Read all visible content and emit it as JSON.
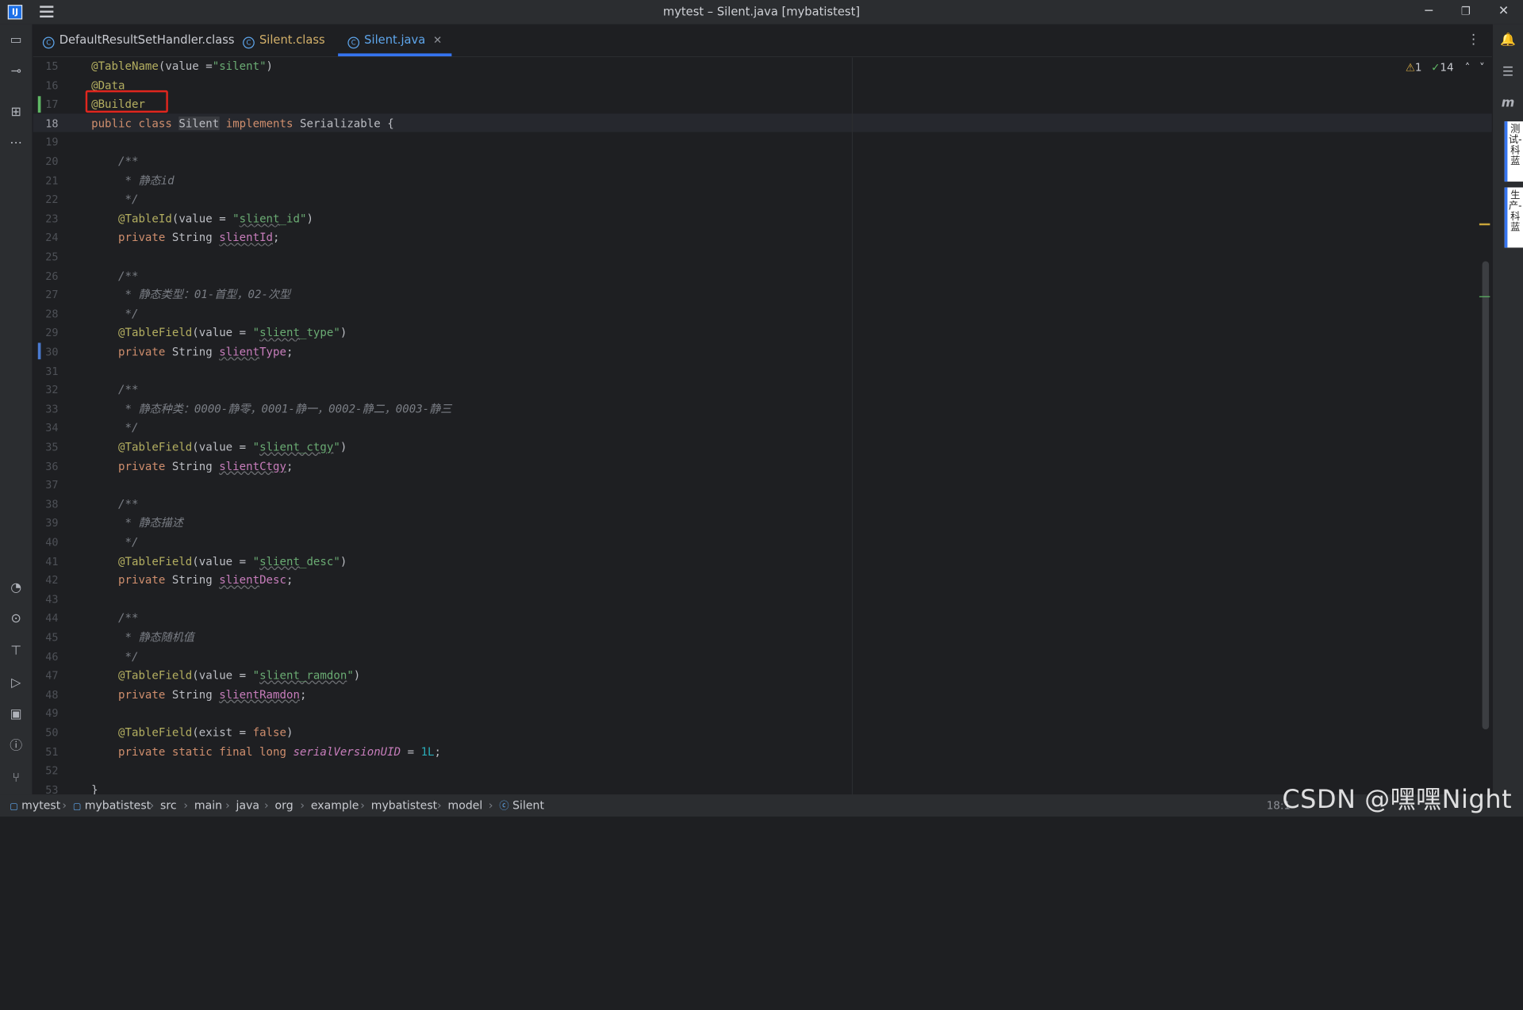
{
  "window": {
    "title": "mytest – Silent.java [mybatistest]",
    "logo_text": "IJ",
    "minimize": "─",
    "maximize": "❐",
    "close": "✕"
  },
  "tabs": [
    {
      "label": "DefaultResultSetHandler.class",
      "active": false
    },
    {
      "label": "Silent.class",
      "active": false
    },
    {
      "label": "Silent.java",
      "active": true
    }
  ],
  "inspections": {
    "warnings": "1",
    "ok": "14"
  },
  "code_lines": [
    {
      "n": "15",
      "html": "<span class=\"ann\">@TableName</span>(value =<span class=\"str\">\"silent\"</span>)"
    },
    {
      "n": "16",
      "html": "<span class=\"ann\">@Data</span>"
    },
    {
      "n": "17",
      "html": "<span class=\"ann\">@Builder</span>"
    },
    {
      "n": "18",
      "html": "<span class=\"kw\">public class</span> <span style=\"background:#393b40\">Silent</span> <span class=\"kw\">implements</span> Serializable {",
      "current": true
    },
    {
      "n": "19",
      "html": ""
    },
    {
      "n": "20",
      "html": "    <span class=\"cmt\">/**</span>"
    },
    {
      "n": "21",
      "html": "    <span class=\"cmt\"> * 静态id</span>"
    },
    {
      "n": "22",
      "html": "    <span class=\"cmt\"> */</span>"
    },
    {
      "n": "23",
      "html": "    <span class=\"ann\">@TableId</span>(value = <span class=\"str\">\"<span class=\"sq\">slient</span>_id\"</span>)"
    },
    {
      "n": "24",
      "html": "    <span class=\"kw\">private</span> String <span class=\"fld sq\">slientId</span>;"
    },
    {
      "n": "25",
      "html": ""
    },
    {
      "n": "26",
      "html": "    <span class=\"cmt\">/**</span>"
    },
    {
      "n": "27",
      "html": "    <span class=\"cmt\"> * 静态类型：01-首型，02-次型</span>"
    },
    {
      "n": "28",
      "html": "    <span class=\"cmt\"> */</span>"
    },
    {
      "n": "29",
      "html": "    <span class=\"ann\">@TableField</span>(value = <span class=\"str\">\"<span class=\"sq\">slient</span>_type\"</span>)"
    },
    {
      "n": "30",
      "html": "    <span class=\"kw\">private</span> String <span class=\"fld\"><span class=\"sq\">slient</span>Type</span>;"
    },
    {
      "n": "31",
      "html": ""
    },
    {
      "n": "32",
      "html": "    <span class=\"cmt\">/**</span>"
    },
    {
      "n": "33",
      "html": "    <span class=\"cmt\"> * 静态种类：0000-静零，0001-静一，0002-静二，0003-静三</span>"
    },
    {
      "n": "34",
      "html": "    <span class=\"cmt\"> */</span>"
    },
    {
      "n": "35",
      "html": "    <span class=\"ann\">@TableField</span>(value = <span class=\"str\">\"<span class=\"sq\">slient_ctgy</span>\"</span>)"
    },
    {
      "n": "36",
      "html": "    <span class=\"kw\">private</span> String <span class=\"fld sq\">slientCtgy</span>;"
    },
    {
      "n": "37",
      "html": ""
    },
    {
      "n": "38",
      "html": "    <span class=\"cmt\">/**</span>"
    },
    {
      "n": "39",
      "html": "    <span class=\"cmt\"> * 静态描述</span>"
    },
    {
      "n": "40",
      "html": "    <span class=\"cmt\"> */</span>"
    },
    {
      "n": "41",
      "html": "    <span class=\"ann\">@TableField</span>(value = <span class=\"str\">\"<span class=\"sq\">slient</span>_desc\"</span>)"
    },
    {
      "n": "42",
      "html": "    <span class=\"kw\">private</span> String <span class=\"fld\"><span class=\"sq\">slient</span>Desc</span>;"
    },
    {
      "n": "43",
      "html": ""
    },
    {
      "n": "44",
      "html": "    <span class=\"cmt\">/**</span>"
    },
    {
      "n": "45",
      "html": "    <span class=\"cmt\"> * 静态随机值</span>"
    },
    {
      "n": "46",
      "html": "    <span class=\"cmt\"> */</span>"
    },
    {
      "n": "47",
      "html": "    <span class=\"ann\">@TableField</span>(value = <span class=\"str\">\"<span class=\"sq\">slient_ramdon</span>\"</span>)"
    },
    {
      "n": "48",
      "html": "    <span class=\"kw\">private</span> String <span class=\"fld sq\">slientRamdon</span>;"
    },
    {
      "n": "49",
      "html": ""
    },
    {
      "n": "50",
      "html": "    <span class=\"ann\">@TableField</span>(exist = <span class=\"kw\">false</span>)"
    },
    {
      "n": "51",
      "html": "    <span class=\"kw\">private static final long</span> <span class=\"fld\" style=\"font-style:italic\">serialVersionUID</span> = <span class=\"num\">1L</span>;"
    },
    {
      "n": "52",
      "html": ""
    },
    {
      "n": "53",
      "html": "}"
    }
  ],
  "breadcrumbs": [
    "mytest",
    "mybatistest",
    "src",
    "main",
    "java",
    "org",
    "example",
    "mybatistest",
    "model",
    "Silent"
  ],
  "status": {
    "position": "18:1"
  },
  "side_tabs": [
    {
      "label": "测试-科蓝"
    },
    {
      "label": "生产-科蓝"
    }
  ],
  "watermark": "CSDN @嘿嘿Night",
  "colors": {
    "accent": "#3574f0",
    "highlight_box": "#e0261e"
  }
}
